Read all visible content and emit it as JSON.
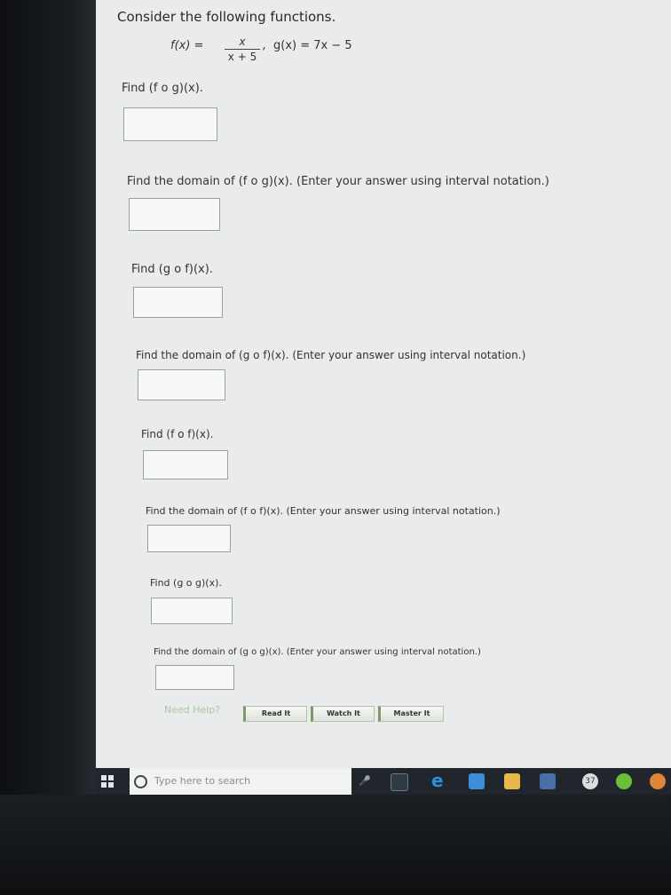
{
  "header": {
    "title": "Consider the following functions."
  },
  "functions": {
    "f_lhs": "f(x) =",
    "f_num": "x",
    "f_den": "x + 5",
    "sep": ",",
    "g": "g(x) = 7x − 5"
  },
  "questions": [
    {
      "label": "Find  (f o g)(x)."
    },
    {
      "label": "Find the domain of  (f o g)(x).  (Enter your answer using interval notation.)"
    },
    {
      "label": "Find  (g o f)(x)."
    },
    {
      "label": "Find the domain of  (g o f)(x).  (Enter your answer using interval notation.)"
    },
    {
      "label": "Find  (f o f)(x)."
    },
    {
      "label": "Find the domain of  (f o f)(x).  (Enter your answer using interval notation.)"
    },
    {
      "label": "Find  (g o g)(x)."
    },
    {
      "label": "Find the domain of  (g o g)(x).  (Enter your answer using interval notation.)"
    }
  ],
  "help": {
    "label": "Need Help?",
    "read": "Read It",
    "watch": "Watch It",
    "master": "Master It"
  },
  "taskbar": {
    "search_placeholder": "Type here to search",
    "badge": "37"
  }
}
